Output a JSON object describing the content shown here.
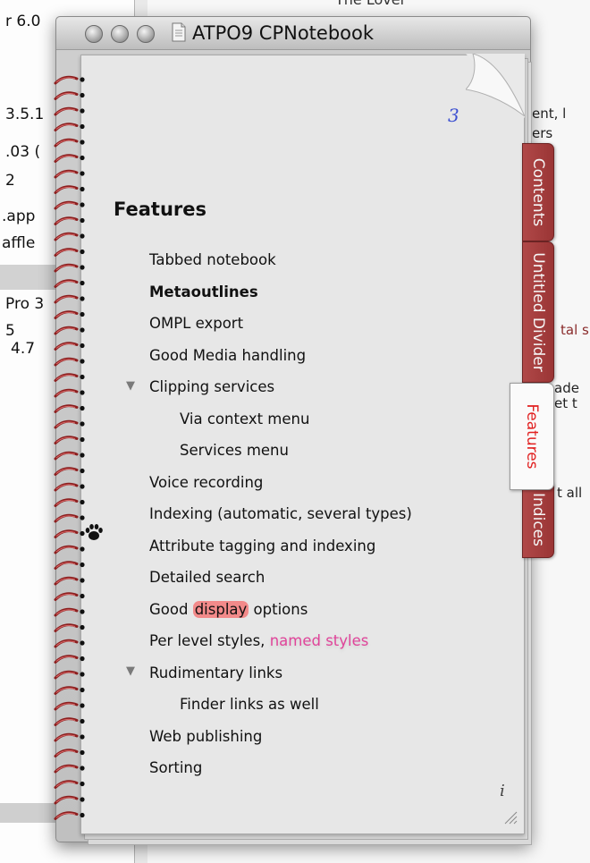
{
  "background_left": {
    "fragments": [
      "r 6.0",
      "3.5.1",
      ".03 (",
      "2",
      ".app",
      "affle",
      "Pro 3",
      "5",
      "4.7"
    ]
  },
  "background_right": {
    "top_text": "The Lover",
    "fragments": [
      "ent, l",
      "ers",
      "tal s",
      "ade",
      "et t",
      "t all"
    ]
  },
  "window": {
    "title": "ATPO9 CPNotebook"
  },
  "page": {
    "number": "3",
    "heading": "Features",
    "items": [
      {
        "text": "Tabbed notebook"
      },
      {
        "text": "Metaoutlines"
      },
      {
        "text": "OMPL export"
      },
      {
        "text": "Good Media handling"
      },
      {
        "text": "Clipping services"
      },
      {
        "text": "Via context menu"
      },
      {
        "text": "Services menu"
      },
      {
        "text": "Voice recording"
      },
      {
        "text": "Indexing (automatic, several types)"
      },
      {
        "text": "Attribute tagging and indexing"
      },
      {
        "text": "Detailed search"
      },
      {
        "text": "Good ",
        "highlight": "display",
        "after": " options"
      },
      {
        "text": "Per level styles, ",
        "styled": "named styles"
      },
      {
        "text": "Rudimentary links"
      },
      {
        "text": "Finder links as well"
      },
      {
        "text": "Web publishing"
      },
      {
        "text": "Sorting"
      }
    ],
    "info_glyph": "i"
  },
  "tabs": [
    {
      "label": "Contents",
      "active": false
    },
    {
      "label": "Untitled Divider",
      "active": false
    },
    {
      "label": "Features",
      "active": true
    },
    {
      "label": "Indices",
      "active": false
    }
  ],
  "colors": {
    "tab_dark": "#a33e3e",
    "tab_active_text": "#e12020",
    "page_number": "#3b4fd1",
    "highlight": "#f28a8a",
    "named_style": "#e0449a"
  },
  "icons": {
    "traffic_lights": [
      "close-icon",
      "minimize-icon",
      "zoom-icon"
    ],
    "document": "document-icon",
    "paw": "paw-icon",
    "info": "info-icon",
    "resize": "resize-grip-icon",
    "disclosure": "disclosure-triangle-icon"
  }
}
